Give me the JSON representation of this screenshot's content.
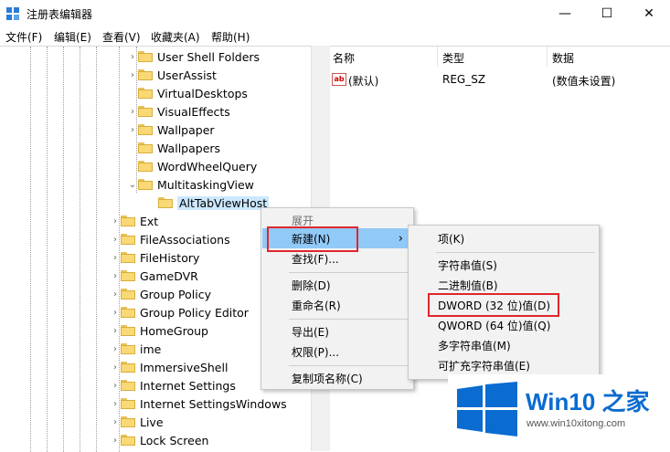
{
  "window": {
    "title": "注册表编辑器",
    "minimize": "—",
    "maximize": "☐",
    "close": "✕"
  },
  "menu": [
    "文件(F)",
    "编辑(E)",
    "查看(V)",
    "收藏夹(A)",
    "帮助(H)"
  ],
  "tree": {
    "items": [
      {
        "label": "User Shell Folders",
        "expand": "›"
      },
      {
        "label": "UserAssist",
        "expand": "›"
      },
      {
        "label": "VirtualDesktops",
        "expand": ""
      },
      {
        "label": "VisualEffects",
        "expand": "›"
      },
      {
        "label": "Wallpaper",
        "expand": "›"
      },
      {
        "label": "Wallpapers",
        "expand": ""
      },
      {
        "label": "WordWheelQuery",
        "expand": ""
      },
      {
        "label": "MultitaskingView",
        "expand": "⌄"
      },
      {
        "label": "AltTabViewHost",
        "expand": ""
      },
      {
        "label": "Ext",
        "expand": "›"
      },
      {
        "label": "FileAssociations",
        "expand": "›"
      },
      {
        "label": "FileHistory",
        "expand": "›"
      },
      {
        "label": "GameDVR",
        "expand": "›"
      },
      {
        "label": "Group Policy",
        "expand": "›"
      },
      {
        "label": "Group Policy Editor",
        "expand": "›"
      },
      {
        "label": "HomeGroup",
        "expand": "›"
      },
      {
        "label": "ime",
        "expand": "›"
      },
      {
        "label": "ImmersiveShell",
        "expand": "›"
      },
      {
        "label": "Internet Settings",
        "expand": "›"
      },
      {
        "label": "Internet SettingsWindows",
        "expand": "›"
      },
      {
        "label": "Live",
        "expand": "›"
      },
      {
        "label": "Lock Screen",
        "expand": "›"
      }
    ]
  },
  "values_pane": {
    "headers": [
      "名称",
      "类型",
      "数据"
    ],
    "rows": [
      {
        "icon": "ab",
        "name": "(默认)",
        "type": "REG_SZ",
        "data": "(数值未设置)"
      }
    ]
  },
  "context_menu": {
    "items": [
      "展开",
      "新建(N)",
      "查找(F)...",
      "删除(D)",
      "重命名(R)",
      "导出(E)",
      "权限(P)...",
      "复制项名称(C)"
    ],
    "submenu_arrow": "›"
  },
  "submenu": {
    "items": [
      "项(K)",
      "字符串值(S)",
      "二进制值(B)",
      "DWORD (32 位)值(D)",
      "QWORD (64 位)值(Q)",
      "多字符串值(M)",
      "可扩充字符串值(E)"
    ]
  },
  "watermark": {
    "brand": "Win10 之家",
    "url": "www.win10xitong.com"
  },
  "colors": {
    "highlight": "#91c9f7",
    "annotation_red": "#e0262d",
    "brand_blue": "#0a6bd0"
  }
}
